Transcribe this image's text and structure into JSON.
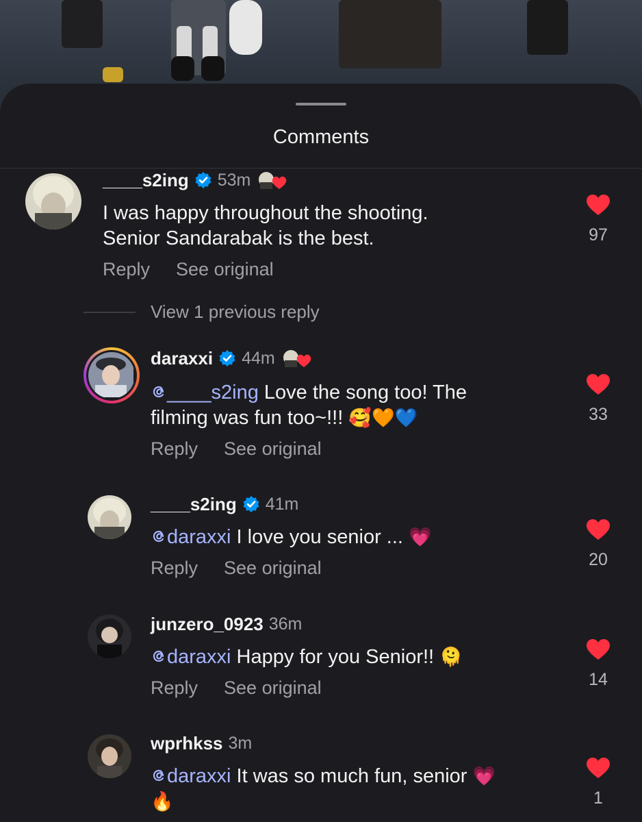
{
  "header": {
    "title": "Comments"
  },
  "comments": [
    {
      "username": "____s2ing",
      "verified": true,
      "time": "53m",
      "creator_liked": true,
      "mention": "",
      "text_line1": "I was happy throughout the shooting.",
      "text_line2": "Senior Sandarabak is the best.",
      "reply_label": "Reply",
      "see_original_label": "See original",
      "likes": "97"
    },
    {
      "username": "daraxxi",
      "verified": true,
      "time": "44m",
      "creator_liked": true,
      "mention": "____s2ing",
      "text_line1": " Love the song too! The",
      "text_line2": "filming was fun too~!!! ",
      "emojis": "🥰🧡💙",
      "reply_label": "Reply",
      "see_original_label": "See original",
      "likes": "33"
    },
    {
      "username": "____s2ing",
      "verified": true,
      "time": "41m",
      "mention": "daraxxi",
      "text_line1": " I love you senior ... ",
      "emojis": "💗",
      "reply_label": "Reply",
      "see_original_label": "See original",
      "likes": "20"
    },
    {
      "username": "junzero_0923",
      "verified": false,
      "time": "36m",
      "mention": "daraxxi",
      "text_line1": " Happy for you Senior!! ",
      "emojis": "🫠",
      "reply_label": "Reply",
      "see_original_label": "See original",
      "likes": "14"
    },
    {
      "username": "wprhkss",
      "verified": false,
      "time": "3m",
      "mention": "daraxxi",
      "text_line1": " It was so much fun, senior ",
      "emojis": "💗",
      "emojis_line2": "🔥",
      "likes": "1"
    }
  ],
  "view_previous_reply": "View 1 previous reply",
  "colors": {
    "like_red": "#ff3040",
    "verified_blue": "#0095f6",
    "mention": "#a7b4ff"
  },
  "icons": {
    "like": "heart-icon",
    "verified": "verified-badge-icon",
    "mention": "threads-at-icon"
  }
}
